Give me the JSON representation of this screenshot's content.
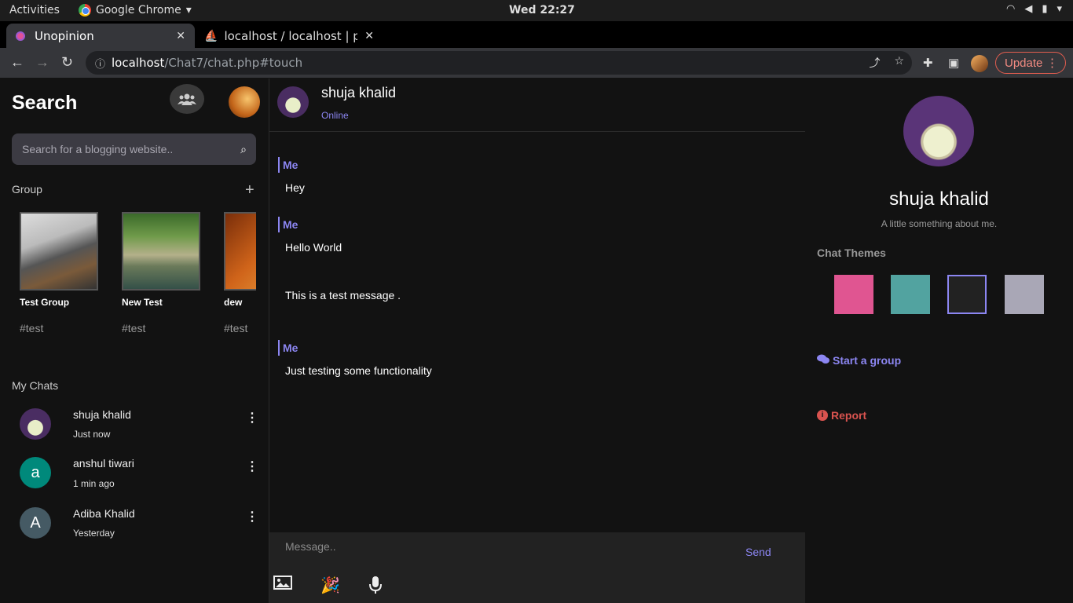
{
  "os_bar": {
    "activities": "Activities",
    "app_name": "Google Chrome",
    "clock": "Wed 22:27"
  },
  "browser": {
    "tabs": [
      {
        "title": "Unopinion",
        "active": true
      },
      {
        "title": "localhost / localhost | php",
        "active": false
      }
    ],
    "url_host": "localhost",
    "url_path": "/Chat7/chat.php#touch",
    "update_label": "Update"
  },
  "sidebar": {
    "title": "Search",
    "search_placeholder": "Search for a blogging website..",
    "group_label": "Group",
    "groups": [
      {
        "name": "Test Group",
        "tag": "#test"
      },
      {
        "name": "New Test",
        "tag": "#test"
      },
      {
        "name": "dew",
        "tag": "#test"
      }
    ],
    "my_chats_label": "My Chats",
    "chats": [
      {
        "name": "shuja khalid",
        "time": "Just now",
        "initial": ""
      },
      {
        "name": "anshul tiwari",
        "time": "1 min ago",
        "initial": "a"
      },
      {
        "name": "Adiba Khalid",
        "time": "Yesterday",
        "initial": "A"
      }
    ]
  },
  "chat": {
    "contact_name": "shuja khalid",
    "status": "Online",
    "messages": [
      {
        "sender": "Me",
        "text": "Hey"
      },
      {
        "sender": "Me",
        "text": "Hello World"
      },
      {
        "sender": "",
        "text": "This is a test message ."
      },
      {
        "sender": "Me",
        "text": "Just testing some functionality"
      }
    ],
    "composer_placeholder": "Message..",
    "send_label": "Send"
  },
  "profile": {
    "name": "shuja khalid",
    "bio": "A little something about me.",
    "themes_label": "Chat Themes",
    "themes": [
      "#e05591",
      "#52a3a0",
      "#222222",
      "#a9a7b6"
    ],
    "selected_theme": 2,
    "start_group": "Start a group",
    "report": "Report"
  },
  "colors": {
    "accent": "#8c86f2",
    "danger": "#d9534f"
  }
}
